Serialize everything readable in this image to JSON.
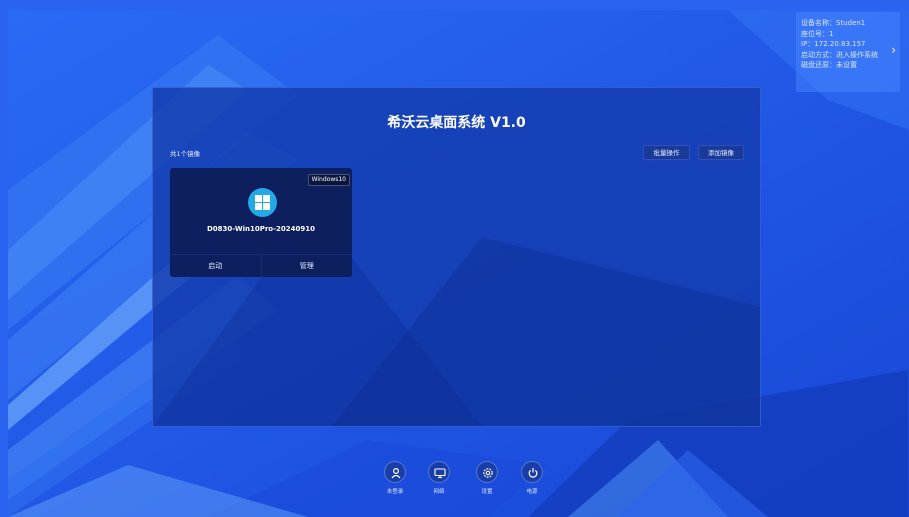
{
  "device_info": {
    "rows": [
      "设备名称：Studen1",
      "座位号：1",
      "IP：172.20.83.157",
      "启动方式：进入操作系统",
      "磁盘还原：未设置"
    ],
    "expand_icon": "chevron-right-icon"
  },
  "panel": {
    "title": "希沃云桌面系统 V1.0",
    "image_count": "共1个镜像",
    "batch_button": "批量操作",
    "add_button": "添加镜像"
  },
  "images": [
    {
      "os_tag": "Windows10",
      "icon": "windows-logo-icon",
      "name": "D0830-Win10Pro-20240910",
      "start_label": "启动",
      "manage_label": "管理"
    }
  ],
  "dock": [
    {
      "label": "未登录",
      "icon": "user-icon"
    },
    {
      "label": "网络",
      "icon": "network-icon"
    },
    {
      "label": "设置",
      "icon": "settings-icon"
    },
    {
      "label": "电源",
      "icon": "power-icon"
    }
  ],
  "colors": {
    "background": "#1f55e6",
    "panel": "#1a44b8",
    "card": "#0d1f5e",
    "windows_blue": "#23a9e8"
  }
}
